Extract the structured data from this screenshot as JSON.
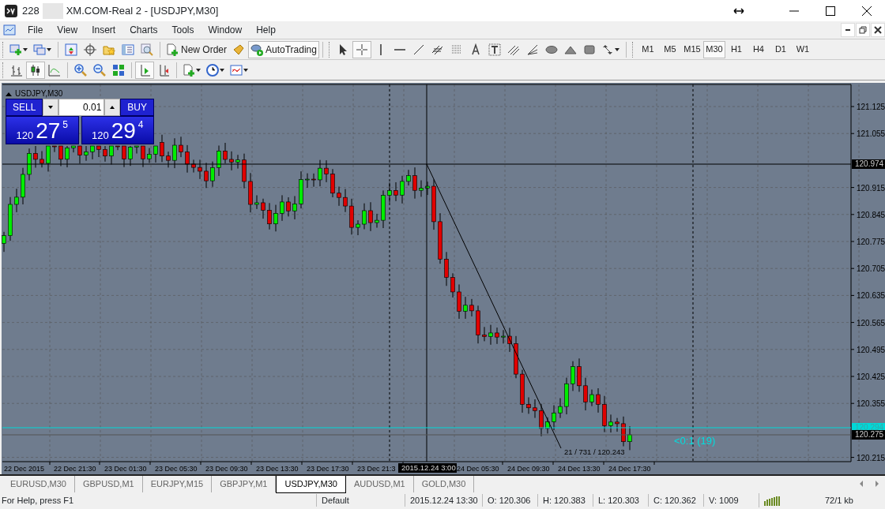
{
  "window": {
    "account": "228",
    "title": "XM.COM-Real 2 - [USDJPY,M30]"
  },
  "menu": [
    "File",
    "View",
    "Insert",
    "Charts",
    "Tools",
    "Window",
    "Help"
  ],
  "toolbar": {
    "new_order": "New Order",
    "autotrading": "AutoTrading",
    "timeframes": [
      {
        "label": "M1",
        "selected": false
      },
      {
        "label": "M5",
        "selected": false
      },
      {
        "label": "M15",
        "selected": false
      },
      {
        "label": "M30",
        "selected": true
      },
      {
        "label": "H1",
        "selected": false
      },
      {
        "label": "H4",
        "selected": false
      },
      {
        "label": "D1",
        "selected": false
      },
      {
        "label": "W1",
        "selected": false
      }
    ]
  },
  "chart": {
    "title": "USDJPY,M30",
    "trade_panel": {
      "sell": "SELL",
      "buy": "BUY",
      "lot": "0.01",
      "sell_price": {
        "big_figure": "120",
        "pips": "27",
        "point": "5"
      },
      "buy_price": {
        "big_figure": "120",
        "pips": "29",
        "point": "4"
      }
    },
    "price_axis": [
      "121.125",
      "121.055",
      "120.915",
      "120.845",
      "120.775",
      "120.705",
      "120.635",
      "120.565",
      "120.495",
      "120.425",
      "120.355",
      "120.215"
    ],
    "price_markers": [
      {
        "kind": "crosshair",
        "label": "120.974"
      },
      {
        "kind": "bid",
        "label": "120.294"
      },
      {
        "kind": "last",
        "label": "120.275"
      }
    ],
    "time_axis": [
      "22 Dec 2015",
      "22 Dec 21:30",
      "23 Dec 01:30",
      "23 Dec 05:30",
      "23 Dec 09:30",
      "23 Dec 13:30",
      "23 Dec 17:30",
      "23 Dec 21:3",
      "24 Dec 05:30",
      "24 Dec 09:30",
      "24 Dec 13:30",
      "24 Dec 17:30"
    ],
    "crosshair_time": "2015.12.24 3:00",
    "measure_label": "21 / 731 / 120.243",
    "countdown": "<0:1 (19)"
  },
  "tabs": [
    {
      "label": "EURUSD,M30",
      "selected": false
    },
    {
      "label": "GBPUSD,M1",
      "selected": false
    },
    {
      "label": "EURJPY,M15",
      "selected": false
    },
    {
      "label": "GBPJPY,M1",
      "selected": false
    },
    {
      "label": "USDJPY,M30",
      "selected": true
    },
    {
      "label": "AUDUSD,M1",
      "selected": false
    },
    {
      "label": "GOLD,M30",
      "selected": false
    }
  ],
  "status_bar": {
    "help": "For Help, press F1",
    "profile": "Default",
    "time": "2015.12.24 13:30",
    "open": "O: 120.306",
    "high": "H: 120.383",
    "low": "L: 120.303",
    "close": "C: 120.362",
    "volume": "V: 1009",
    "traffic": "72/1 kb"
  }
}
